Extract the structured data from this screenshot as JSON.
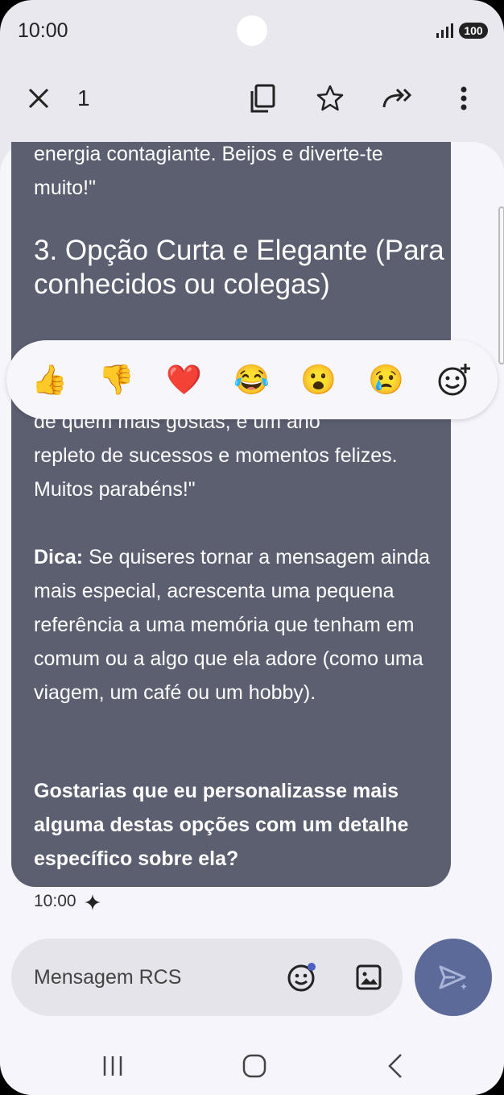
{
  "status": {
    "time": "10:00",
    "battery": "100"
  },
  "toolbar": {
    "selected_count": "1"
  },
  "message": {
    "top_text": "energia contagiante. Beijos e diverte-te muito!\"",
    "heading": "3. Opção Curta e Elegante (Para conhecidos ou colegas)",
    "partial_line": "de quem mais gostas, e um ano",
    "body_text": "repleto de sucessos e momentos felizes. Muitos parabéns!\"",
    "tip_label": "Dica:",
    "tip_text": " Se quiseres tornar a mensagem ainda mais especial, acrescenta uma pequena referência a uma memória que tenham em comum ou a algo que ela adore (como uma viagem, um café ou um hobby).",
    "question": "Gostarias que eu personalizasse mais alguma destas opções com um detalhe específico sobre ela?",
    "time": "10:00"
  },
  "reactions": [
    "👍",
    "👎",
    "❤️",
    "😂",
    "😮",
    "😢"
  ],
  "input": {
    "placeholder": "Mensagem RCS"
  },
  "colors": {
    "bubble": "#5b5f70",
    "send": "#5c6a9a",
    "background": "#f5f5fb"
  }
}
